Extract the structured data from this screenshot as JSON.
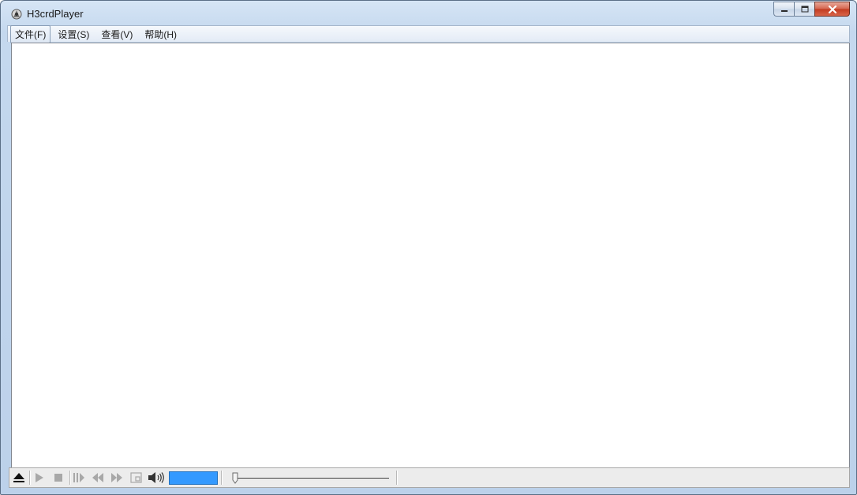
{
  "window": {
    "title": "H3crdPlayer"
  },
  "menu": {
    "items": [
      {
        "label": "文件(F)",
        "active": true
      },
      {
        "label": "设置(S)",
        "active": false
      },
      {
        "label": "查看(V)",
        "active": false
      },
      {
        "label": "帮助(H)",
        "active": false
      }
    ]
  },
  "controls": {
    "icons": [
      "eject-icon",
      "play-icon",
      "stop-icon",
      "step-forward-icon",
      "rewind-icon",
      "fast-forward-icon",
      "fullscreen-icon",
      "speaker-icon"
    ],
    "volume_level": 1.0,
    "seek_position": 0.0
  },
  "colors": {
    "volume_fill": "#3399ff",
    "close_button": "#c8452c"
  }
}
